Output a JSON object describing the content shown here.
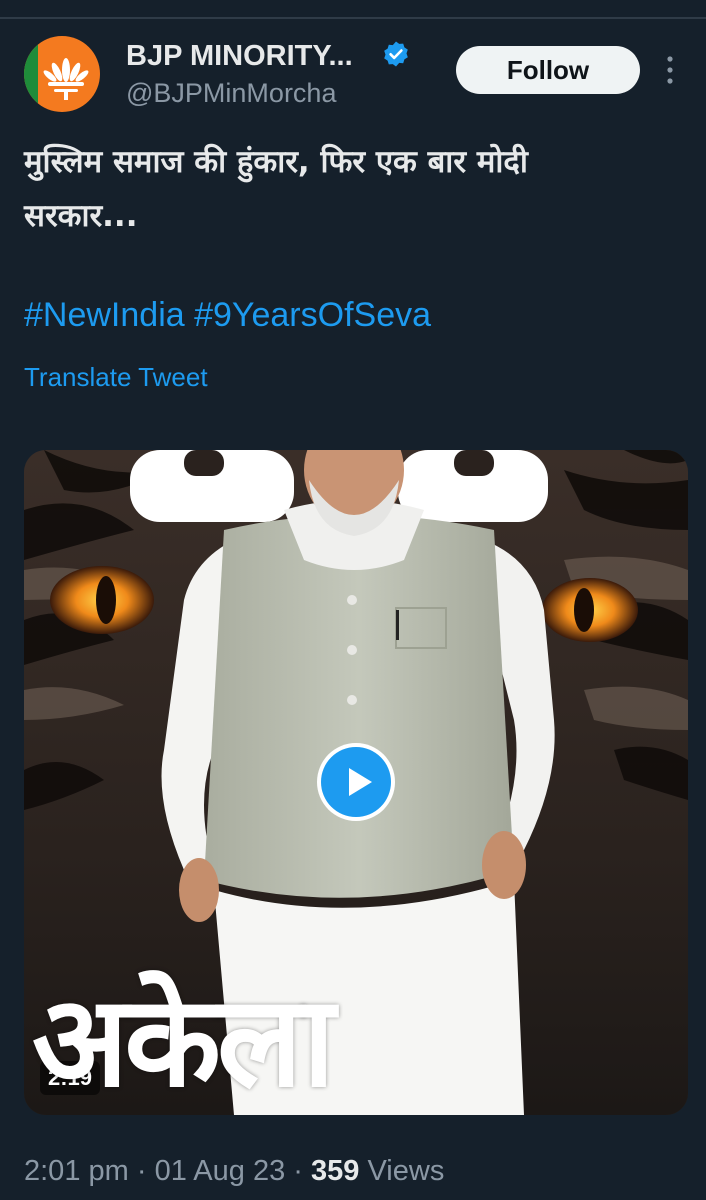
{
  "author": {
    "name": "BJP MINORITY...",
    "handle": "@BJPMinMorcha",
    "avatar_icon": "bjp-lotus-logo",
    "verified_icon": "verified-badge-icon"
  },
  "actions": {
    "follow_label": "Follow",
    "more_icon": "more-vertical-icon"
  },
  "tweet": {
    "text_line1": "मुस्लिम समाज की हुंकार, फिर एक बार मोदी",
    "text_line2": "सरकार...",
    "hashtag1": "#NewIndia",
    "hashtag2": "#9YearsOfSeva",
    "translate_label": "Translate Tweet"
  },
  "media": {
    "type": "video",
    "overlay_text": "अकेला",
    "duration": "2:19",
    "play_icon": "play-icon"
  },
  "meta": {
    "time": "2:01 pm",
    "separator": "·",
    "date": "01 Aug 23",
    "views_count": "359",
    "views_label": "Views"
  },
  "colors": {
    "background": "#15202b",
    "accent": "#1d9bf0",
    "secondary_text": "#8b98a5",
    "primary_text": "#e7e9ea"
  }
}
